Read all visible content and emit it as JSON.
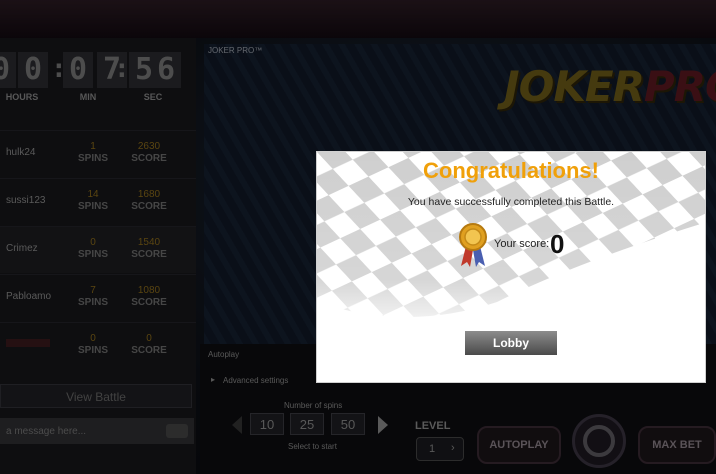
{
  "game": {
    "brand_small": "JOKER PRO™",
    "logo_main": "JOKER",
    "logo_accent": "PRO"
  },
  "timer": {
    "hours": [
      "0",
      "0"
    ],
    "minutes": [
      "0",
      "7"
    ],
    "seconds": [
      "5",
      "6"
    ],
    "hours_label": "HOURS",
    "minutes_label": "MIN",
    "seconds_label": "SEC"
  },
  "leaderboard": {
    "spins_label": "SPINS",
    "score_label": "SCORE",
    "rows": [
      {
        "name": "hulk24",
        "spins": "1",
        "score": "2630"
      },
      {
        "name": "sussi123",
        "spins": "14",
        "score": "1680"
      },
      {
        "name": "Crimez",
        "spins": "0",
        "score": "1540"
      },
      {
        "name": "Pabloamo",
        "spins": "7",
        "score": "1080"
      },
      {
        "name": "",
        "spins": "0",
        "score": "0"
      }
    ],
    "view_battle_label": "View Battle",
    "message_placeholder": "a message here..."
  },
  "controls": {
    "autoplay_label": "Autoplay",
    "advanced_settings_label": "Advanced settings",
    "number_of_spins_label": "Number of spins",
    "spin_options": [
      "10",
      "25",
      "50"
    ],
    "select_to_start_label": "Select to start",
    "level_label": "LEVEL",
    "level_value": "1",
    "autoplay_button": "AUTOPLAY",
    "max_bet_button": "MAX BET"
  },
  "modal": {
    "title": "Congratulations!",
    "message": "You have successfully completed this Battle.",
    "score_label": "Your score:",
    "score_value": "0",
    "lobby_button": "Lobby"
  },
  "colors": {
    "title_orange": "#f0a00a",
    "score_gold": "#8a6a1a",
    "lobby_button": "#6b6b6b"
  }
}
